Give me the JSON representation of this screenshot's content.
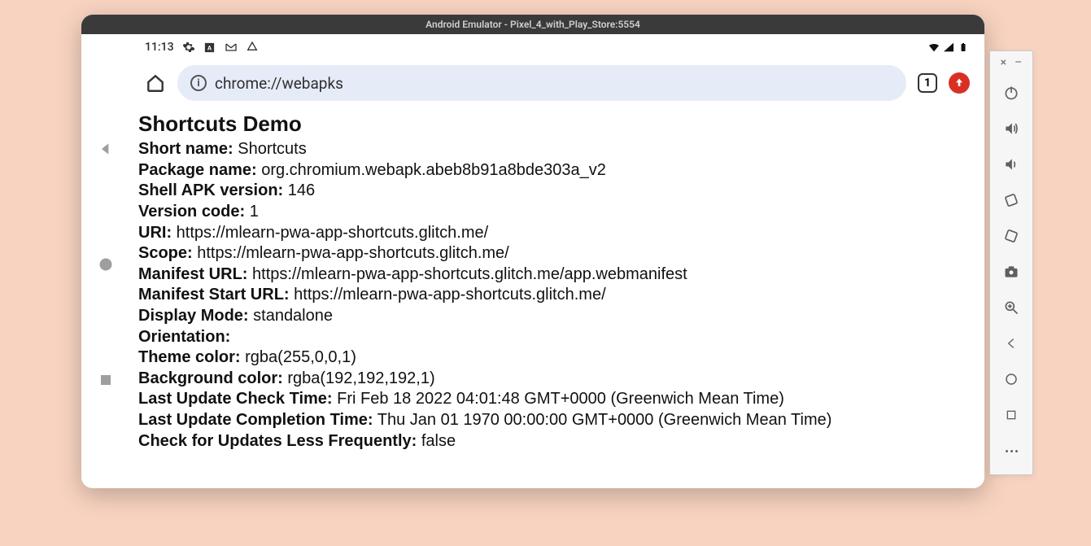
{
  "window_title": "Android Emulator - Pixel_4_with_Play_Store:5554",
  "status_bar": {
    "time": "11:13"
  },
  "chrome": {
    "url": "chrome://webapks",
    "tab_count": "1"
  },
  "page": {
    "title": "Shortcuts Demo",
    "fields": [
      {
        "label": "Short name:",
        "value": "Shortcuts"
      },
      {
        "label": "Package name:",
        "value": "org.chromium.webapk.abeb8b91a8bde303a_v2"
      },
      {
        "label": "Shell APK version:",
        "value": "146"
      },
      {
        "label": "Version code:",
        "value": "1"
      },
      {
        "label": "URI:",
        "value": "https://mlearn-pwa-app-shortcuts.glitch.me/"
      },
      {
        "label": "Scope:",
        "value": "https://mlearn-pwa-app-shortcuts.glitch.me/"
      },
      {
        "label": "Manifest URL:",
        "value": "https://mlearn-pwa-app-shortcuts.glitch.me/app.webmanifest"
      },
      {
        "label": "Manifest Start URL:",
        "value": "https://mlearn-pwa-app-shortcuts.glitch.me/"
      },
      {
        "label": "Display Mode:",
        "value": "standalone"
      },
      {
        "label": "Orientation:",
        "value": ""
      },
      {
        "label": "Theme color:",
        "value": "rgba(255,0,0,1)"
      },
      {
        "label": "Background color:",
        "value": "rgba(192,192,192,1)"
      },
      {
        "label": "Last Update Check Time:",
        "value": "Fri Feb 18 2022 04:01:48 GMT+0000 (Greenwich Mean Time)"
      },
      {
        "label": "Last Update Completion Time:",
        "value": "Thu Jan 01 1970 00:00:00 GMT+0000 (Greenwich Mean Time)"
      },
      {
        "label": "Check for Updates Less Frequently:",
        "value": "false"
      }
    ]
  }
}
